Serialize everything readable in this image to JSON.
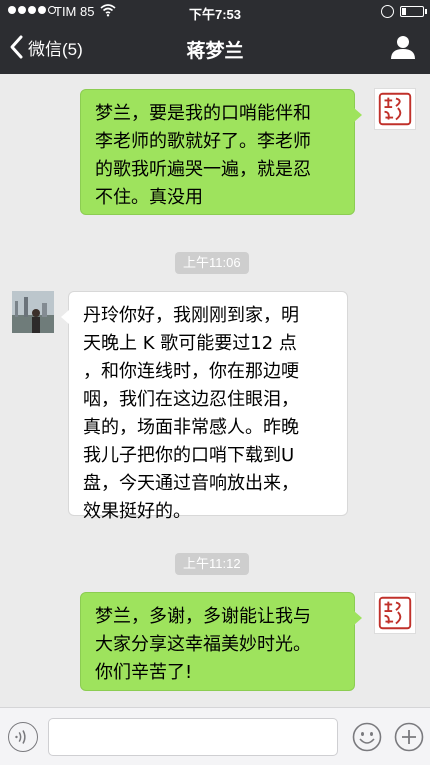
{
  "status_bar": {
    "carrier": "TIM 85",
    "time": "下午7:53"
  },
  "nav": {
    "back_label": "微信(5)",
    "title": "蒋梦兰"
  },
  "messages": [
    {
      "sender": "me",
      "lines": [
        "梦兰，要是我的口哨能伴和",
        "李老师的歌就好了。李老师",
        "的歌我听遍哭一遍，就是忍",
        "不住。真没用"
      ]
    },
    {
      "sender": "them",
      "lines": [
        "丹玲你好，我刚刚到家，明",
        "天晚上 K 歌可能要过12 点",
        "，和你连线时，你在那边哽",
        "咽，我们在这边忍住眼泪，",
        "真的，场面非常感人。昨晚",
        "我儿子把你的口哨下载到U",
        "盘，今天通过音响放出来，",
        "效果挺好的。"
      ]
    },
    {
      "sender": "me",
      "lines": [
        "梦兰，多谢，多谢能让我与",
        "大家分享这幸福美妙时光。",
        "你们辛苦了!"
      ]
    }
  ],
  "timestamps": [
    "上午11:06",
    "上午11:12"
  ],
  "colors": {
    "nav_bg": "#2c2d31",
    "my_bubble": "#9ee35d",
    "their_bubble": "#ffffff",
    "chat_bg": "#ebebeb",
    "seal_red": "#c0302a"
  },
  "input_bar": {
    "voice_icon": "voice-icon",
    "emoji_icon": "emoji-icon",
    "plus_icon": "plus-icon"
  }
}
